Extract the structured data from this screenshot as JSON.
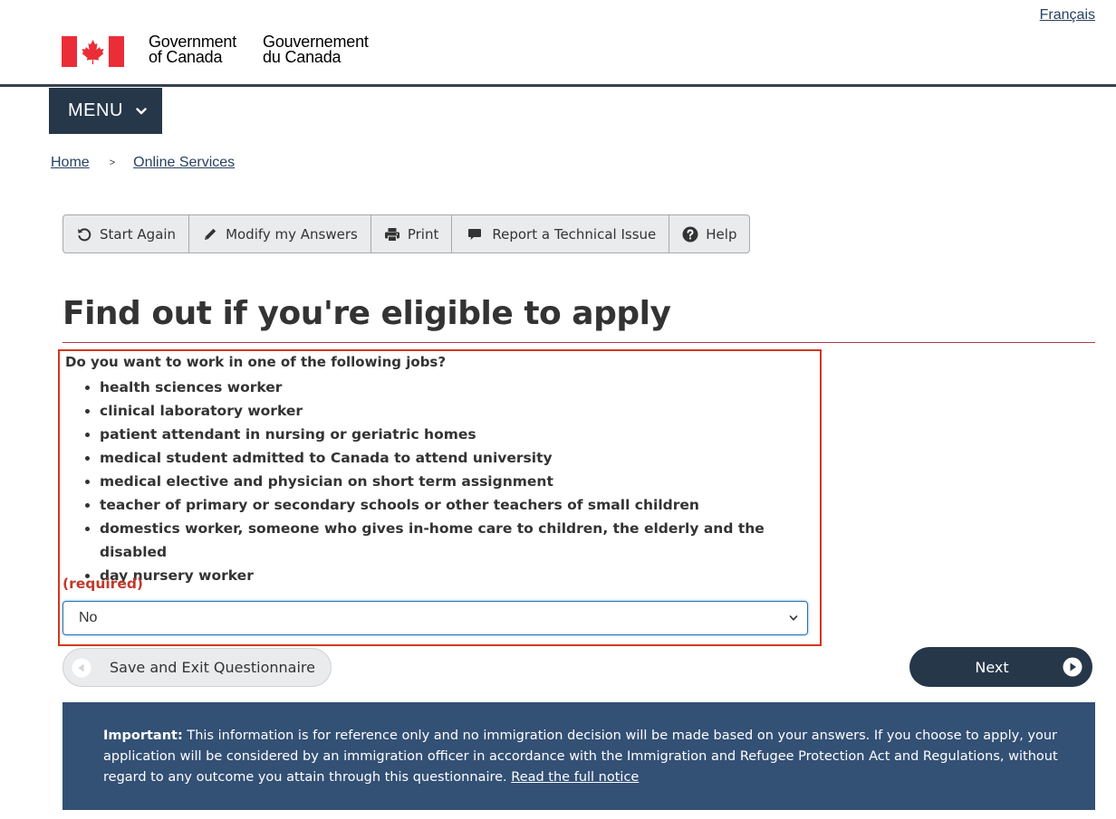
{
  "header": {
    "language_link": "Français",
    "signature_en_line1": "Government",
    "signature_en_line2": "of Canada",
    "signature_fr_line1": "Gouvernement",
    "signature_fr_line2": "du Canada",
    "flag_color": "#eb2d37"
  },
  "menu": {
    "label": "MENU"
  },
  "breadcrumb": {
    "items": [
      {
        "label": "Home"
      },
      {
        "label": "Online Services"
      }
    ],
    "separator": ">"
  },
  "toolbar": {
    "buttons": [
      {
        "label": "Start Again",
        "icon": "refresh-icon"
      },
      {
        "label": "Modify my Answers",
        "icon": "pencil-icon"
      },
      {
        "label": "Print",
        "icon": "print-icon"
      },
      {
        "label": "Report a Technical Issue",
        "icon": "comment-icon"
      },
      {
        "label": "Help",
        "icon": "question-icon"
      }
    ]
  },
  "main": {
    "title": "Find out if you're eligible to apply",
    "question": {
      "label": "Do you want to work in one of the following jobs?",
      "jobs": [
        "health sciences worker",
        "clinical laboratory worker",
        "patient attendant in nursing or geriatric homes",
        "medical student admitted to Canada to attend university",
        "medical elective and physician on short term assignment",
        "teacher of primary or secondary schools or other teachers of small children",
        "domestics worker, someone who gives in-home care to children, the elderly and the disabled",
        "day nursery worker"
      ],
      "required_text": "(required)",
      "selected_value": "No",
      "highlight_color": "#d3361f"
    }
  },
  "actions": {
    "save_label": "Save and Exit Questionnaire",
    "next_label": "Next"
  },
  "notice": {
    "heading": "Important:",
    "body": "This information is for reference only and no immigration decision will be made based on your answers. If you choose to apply, your application will be considered by an immigration officer in accordance with the Immigration and Refugee Protection Act and Regulations, without regard to any outcome you attain through this questionnaire.",
    "link_text": "Read the full notice",
    "background_color": "#335075"
  }
}
